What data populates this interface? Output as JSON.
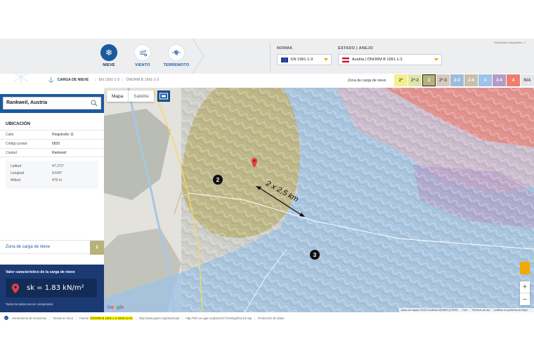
{
  "header": {
    "hazards": [
      {
        "label": "NIEVE",
        "icon": "snowflake-icon",
        "active": true
      },
      {
        "label": "VIENTO",
        "icon": "wind-icon",
        "active": false
      },
      {
        "label": "TERREMOTO",
        "icon": "seismograph-icon",
        "active": false
      }
    ],
    "norma_label": "NORMA",
    "norma_value": "EN 1991-1-3",
    "estado_label": "ESTADO | ANEJO",
    "estado_value": "Austria | ÖNORM B 1991-1-3",
    "downloads": "Solicitudes disponibles: 1"
  },
  "breadcrumb": {
    "current": "CARGA DE NIEVE",
    "items": [
      "EN 1991-1-3",
      "ÖNORM B 1991-1-3"
    ]
  },
  "legend": {
    "title": "Zona de carga de nieve",
    "zones": [
      {
        "label": "2*",
        "color": "#f4f08a",
        "dark": true
      },
      {
        "label": "2*-2",
        "color": "#dfe7a6",
        "dark": true
      },
      {
        "label": "2",
        "color": "#b7b27b",
        "selected": true
      },
      {
        "label": "2*-3",
        "color": "#d9c8c0",
        "dark": true
      },
      {
        "label": "2-3",
        "color": "#9ebbd8"
      },
      {
        "label": "2-4",
        "color": "#c7bfae"
      },
      {
        "label": "3",
        "color": "#9cc3e8"
      },
      {
        "label": "3-4",
        "color": "#b49bc8"
      },
      {
        "label": "4",
        "color": "#f07e6e"
      },
      {
        "label": "N/A",
        "color": "#e5e7ea",
        "dark": true
      }
    ]
  },
  "location": {
    "search_value": "Rankweil, Austria",
    "section_title": "UBICACIÓN",
    "address": [
      {
        "key": "Calle",
        "value": "Ringstraße 11"
      },
      {
        "key": "Código postal",
        "value": "6830"
      },
      {
        "key": "Ciudad",
        "value": "Rankweil"
      }
    ],
    "coords": [
      {
        "key": "Latitud",
        "value": "47.271°"
      },
      {
        "key": "Longitud",
        "value": "9.643°"
      },
      {
        "key": "Altitud",
        "value": "470 m"
      }
    ]
  },
  "zone": {
    "label": "Zona de carga de nieve",
    "value": "2"
  },
  "result": {
    "title": "Valor característico de la carga de nieve",
    "value": "sk = 1.83 kN/m²",
    "note": "Todos los datos son sin compromiso"
  },
  "map": {
    "type_map": "Mapa",
    "type_satellite": "Satélite",
    "marker_zone_2": "2",
    "marker_zone_3": "3",
    "distance_label": "2 x 2,5 km",
    "google": "Google",
    "attribution": [
      "Datos de mapas ©2019 GeoBasis-DE/BKG (©2009)",
      "2 km",
      "Términos de uso",
      "Notificar un problema de Maps"
    ]
  },
  "footer": {
    "items": [
      "Herramienta de Geozonas",
      "Tienda en línea",
      "Fuente:",
      "ÖNORM B 1991-1-3 2018-12-01",
      "http://www.gadm.org/download",
      "http://info.ve.ogan.org/SELECTION/egalCoord.asp",
      "Protección de datos"
    ]
  }
}
